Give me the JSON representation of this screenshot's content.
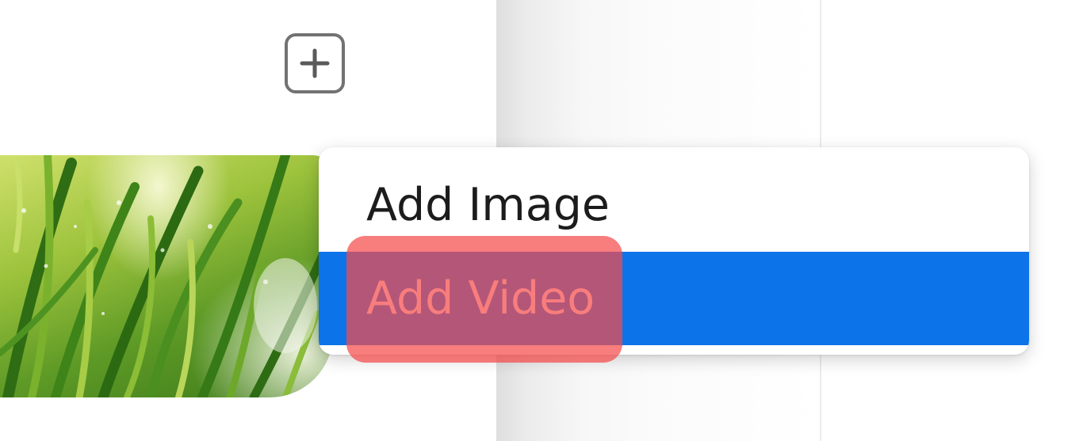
{
  "toolbar": {
    "add_icon": "plus-icon"
  },
  "thumbnail": {
    "image": "grass-photo"
  },
  "menu": {
    "items": [
      {
        "label": "Add Image",
        "state": "normal"
      },
      {
        "label": "Add Video",
        "state": "highlighted"
      }
    ]
  },
  "colors": {
    "selection": "#0d73e8",
    "annotation": "#f54b4b",
    "icon": "#727272"
  }
}
